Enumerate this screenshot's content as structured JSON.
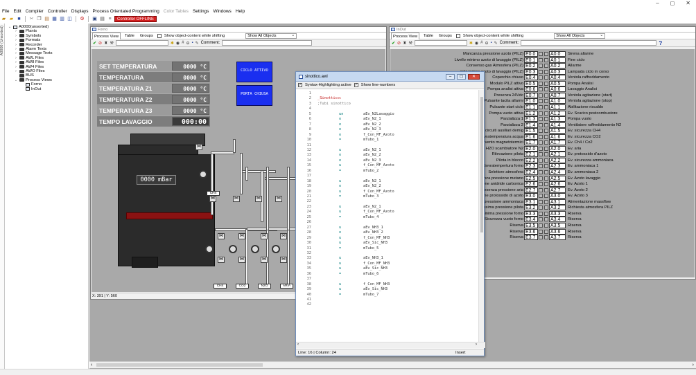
{
  "window": {
    "minimize": "–",
    "maximize": "◻",
    "close": "✕"
  },
  "menu": [
    "File",
    "Edit",
    "Compiler",
    "Controller",
    "Displays",
    "Process Orientated Programming",
    "Color Tables",
    "Settings",
    "Windows",
    "Help"
  ],
  "toolbar": {
    "controller_status": "Controller OFFLINE"
  },
  "left_panel": {
    "vtab": "A0000 (Unsorted)"
  },
  "tree": [
    {
      "label": "A0000(unsorted)",
      "depth": 0,
      "expand": "⌄",
      "icon": "chart"
    },
    {
      "label": "Plants",
      "depth": 1,
      "expand": "›",
      "icon": "folder"
    },
    {
      "label": "Symbols",
      "depth": 1,
      "expand": "›",
      "icon": "folder"
    },
    {
      "label": "Formats",
      "depth": 1,
      "expand": "›",
      "icon": "folder"
    },
    {
      "label": "Recorder",
      "depth": 1,
      "expand": "›",
      "icon": "folder"
    },
    {
      "label": "Alarm Texts",
      "depth": 1,
      "expand": "›",
      "icon": "folder"
    },
    {
      "label": "Message Texts",
      "depth": 1,
      "expand": "›",
      "icon": "folder"
    },
    {
      "label": "AWL Files",
      "depth": 1,
      "expand": "›",
      "icon": "folder"
    },
    {
      "label": "AW8 Files",
      "depth": 1,
      "expand": "›",
      "icon": "folder"
    },
    {
      "label": "AW4 Files",
      "depth": 1,
      "expand": "›",
      "icon": "folder"
    },
    {
      "label": "AWO Files",
      "depth": 1,
      "expand": "›",
      "icon": "folder"
    },
    {
      "label": "BUS",
      "depth": 1,
      "expand": "",
      "icon": "folder"
    },
    {
      "label": "Process Views",
      "depth": 1,
      "expand": "⌄",
      "icon": "folder"
    },
    {
      "label": "Forno",
      "depth": 2,
      "expand": "",
      "icon": "chart"
    },
    {
      "label": "InOut",
      "depth": 2,
      "expand": "",
      "icon": "chart"
    }
  ],
  "forno": {
    "title": "Forno",
    "tabs": [
      "Process View",
      "Table",
      "Groups"
    ],
    "show_object_content": "Show object-content while shifting",
    "filter": "Show All Objects",
    "comment_label": "Comment:",
    "temps": [
      {
        "label": "SET TEMPERATURA",
        "value": "0000 °C"
      },
      {
        "label": "TEMPERATURA",
        "value": "0000 °C"
      },
      {
        "label": "TEMPERATURA Z1",
        "value": "0000 °C"
      },
      {
        "label": "TEMPERATURA Z2",
        "value": "0000 °C"
      },
      {
        "label": "TEMPERATURA Z3",
        "value": "0000 °C"
      },
      {
        "label": "TEMPO LAVAGGIO",
        "value": "000:00"
      }
    ],
    "btn_1": "CICLO ATTIVO",
    "btn_2": "PORTA CHIUSA",
    "pressure": "0000 mBar",
    "gases": [
      "CH4",
      "CH4",
      "CO2",
      "N2O",
      "ARIA"
    ],
    "coords": "X: 391 | Y: 560"
  },
  "inout": {
    "title": "InOut",
    "tabs": [
      "Process View",
      "Table",
      "Groups"
    ],
    "show_object_content": "Show object-content while shifting",
    "filter": "Show All Objects",
    "comment_label": "Comment:",
    "help": "?",
    "rows": [
      {
        "in": "Mancanza pressione azoto (PILZ)",
        "in_addr": "E0.0",
        "out_addr": "A0.0",
        "out": "Sirena allarme"
      },
      {
        "in": "Livello minimo azoto di lavaggio (PILZ)",
        "in_addr": "E0.1",
        "out_addr": "A0.1",
        "out": "Fine ciclo"
      },
      {
        "in": "Consenso gas Atmosfera (PILZ)",
        "in_addr": "E0.2",
        "out_addr": "A0.2",
        "out": "Allarme"
      },
      {
        "in": "ggio tempo azoto di lavaggio (PILZ)",
        "in_addr": "E0.3",
        "out_addr": "A0.3",
        "out": "Lampada ciclo in corso"
      },
      {
        "in": "Coperchio chiuso",
        "in_addr": "E0.4",
        "out_addr": "A0.4",
        "out": "Ventola raffreddamento"
      },
      {
        "in": "Modulo PILZ attivo",
        "in_addr": "E0.5",
        "out_addr": "A0.5",
        "out": "Pompa Analisi"
      },
      {
        "in": "Pompa analisi attiva",
        "in_addr": "E0.6",
        "out_addr": "A0.6",
        "out": "Lavaggio Analisi"
      },
      {
        "in": "Presenza 24Vdc",
        "in_addr": "E0.7",
        "out_addr": "A0.7",
        "out": "Ventola agitazione (start)"
      },
      {
        "in": "Pulsante tacita allarmi",
        "in_addr": "E1.0",
        "out_addr": "A1.0",
        "out": "Ventola agitazione (stop)"
      },
      {
        "in": "Pulsante start ciclo",
        "in_addr": "E1.1",
        "out_addr": "A1.1",
        "out": "Abilitazione riscaldo"
      },
      {
        "in": "Pompa vuoto attiva",
        "in_addr": "E1.2",
        "out_addr": "A1.2",
        "out": "Ev. Scarico postcombustore"
      },
      {
        "in": "Parzializza 1",
        "in_addr": "E1.3",
        "out_addr": "A1.3",
        "out": "Pompa vuoto"
      },
      {
        "in": "Parzializza 2",
        "in_addr": "E1.4",
        "out_addr": "A1.4",
        "out": "Ventilatore raffreddamento N2"
      },
      {
        "in": "Allarme circuiti ausiliari demig",
        "in_addr": "E1.5",
        "out_addr": "A1.5",
        "out": "Ev. sicurezza CH4"
      },
      {
        "in": "Sovratemperatura acqua",
        "in_addr": "E1.6",
        "out_addr": "A1.6",
        "out": "Ev. sicurezza CO2"
      },
      {
        "in": "Intervento magnetotermici",
        "in_addr": "E1.7",
        "out_addr": "A1.7",
        "out": "Ev. Ch4 / Co2"
      },
      {
        "in": "emperatura H2O scambiatore N2",
        "in_addr": "E2.0",
        "out_addr": "A2.0",
        "out": "Ev. aria"
      },
      {
        "in": "Rilevazione pilota",
        "in_addr": "E2.1",
        "out_addr": "A2.1",
        "out": "Ev. protossido d'azoto"
      },
      {
        "in": "Pilota in blocco",
        "in_addr": "E2.2",
        "out_addr": "A2.2",
        "out": "Ev. sicurezza ammoniaca"
      },
      {
        "in": "Sovratempertura forno",
        "in_addr": "E2.3",
        "out_addr": "A2.3",
        "out": "Ev. ammoniaca 1"
      },
      {
        "in": "Selettore atmosfera",
        "in_addr": "E2.4",
        "out_addr": "A2.4",
        "out": "Ev. ammoniaca 2"
      },
      {
        "in": "ostato presenza pressione metano",
        "in_addr": "E2.5",
        "out_addr": "A2.5",
        "out": "Ev. Azoto lavaggio"
      },
      {
        "in": "enza pressione anidride carbonica",
        "in_addr": "E2.6",
        "out_addr": "A2.6",
        "out": "Ev. Azoto 1"
      },
      {
        "in": "essostato presenza pressione aria",
        "in_addr": "E2.7",
        "out_addr": "A2.7",
        "out": "Ev. Azoto 2"
      },
      {
        "in": "essione protossido di azoto",
        "in_addr": "E3.0",
        "out_addr": "A3.0",
        "out": "Ev. Azoto 3"
      },
      {
        "in": "o presenza pressione ammoniaca",
        "in_addr": "E3.1",
        "out_addr": "A3.1",
        "out": "Alimentazione massflow"
      },
      {
        "in": "Minima/Massima pressione pilota",
        "in_addr": "E3.2",
        "out_addr": "A3.2",
        "out": "Richiesta atmosfera PILZ"
      },
      {
        "in": "Sicurezza minima pressione forno",
        "in_addr": "E3.3",
        "out_addr": "A3.3",
        "out": "Riserva"
      },
      {
        "in": "Sicurezza vuoto forno",
        "in_addr": "E3.4",
        "out_addr": "A3.4",
        "out": "Riserva"
      },
      {
        "in": "Riserva",
        "in_addr": "E3.5",
        "out_addr": "A3.5",
        "out": "Riserva"
      },
      {
        "in": "Riserva",
        "in_addr": "E3.6",
        "out_addr": "A3.6",
        "out": "Riserva"
      },
      {
        "in": "Riserva",
        "in_addr": "E3.7",
        "out_addr": "A3.7",
        "out": "Riserva"
      }
    ]
  },
  "editor": {
    "title": "sinottico.awl",
    "opt_syntax": "Syntax-Highlighting active",
    "opt_lines": "Show line-numbers",
    "status_pos": "Line: 16 | Column: 24",
    "status_mode": "Insert",
    "lines": [
      {
        "n": "1",
        "kind": "blank",
        "op": "",
        "txt": ""
      },
      {
        "n": "2",
        "kind": "label",
        "op": "",
        "txt": "_Sinottico:"
      },
      {
        "n": "3",
        "kind": "comment",
        "op": "",
        "txt": ";Tubi sinottico"
      },
      {
        "n": "4",
        "kind": "blank",
        "op": "",
        "txt": ""
      },
      {
        "n": "5",
        "kind": "code",
        "op": "un",
        "txt": "aEv_N2Lavaggio"
      },
      {
        "n": "6",
        "kind": "code",
        "op": "o",
        "txt": "aEv_N2_1"
      },
      {
        "n": "7",
        "kind": "code",
        "op": "o",
        "txt": "aEv_N2_2"
      },
      {
        "n": "8",
        "kind": "code",
        "op": "o",
        "txt": "aEv_N2_3"
      },
      {
        "n": "9",
        "kind": "code",
        "op": "o",
        "txt": "f_Con_MF_Azoto"
      },
      {
        "n": "10",
        "kind": "code",
        "op": "=",
        "txt": "mTubo_1"
      },
      {
        "n": "11",
        "kind": "blank",
        "op": "",
        "txt": ""
      },
      {
        "n": "12",
        "kind": "code",
        "op": "u",
        "txt": "aEv_N2_1"
      },
      {
        "n": "13",
        "kind": "code",
        "op": "o",
        "txt": "aEv_N2_2"
      },
      {
        "n": "14",
        "kind": "code",
        "op": "o",
        "txt": "aEv_N2_3"
      },
      {
        "n": "15",
        "kind": "code",
        "op": "u",
        "txt": "f_Con_MF_Azoto"
      },
      {
        "n": "16",
        "kind": "code",
        "op": "=",
        "txt": "mTubo_2"
      },
      {
        "n": "17",
        "kind": "blank",
        "op": "",
        "txt": ""
      },
      {
        "n": "18",
        "kind": "code",
        "op": "u",
        "txt": "aEv_N2_1"
      },
      {
        "n": "19",
        "kind": "code",
        "op": "o",
        "txt": "aEv_N2_2"
      },
      {
        "n": "20",
        "kind": "code",
        "op": "u",
        "txt": "f_Con_MF_Azoto"
      },
      {
        "n": "21",
        "kind": "code",
        "op": "=",
        "txt": "mTubo_3"
      },
      {
        "n": "22",
        "kind": "blank",
        "op": "",
        "txt": ""
      },
      {
        "n": "23",
        "kind": "code",
        "op": "u",
        "txt": "aEv_N2_1"
      },
      {
        "n": "24",
        "kind": "code",
        "op": "u",
        "txt": "f_Con_MF_Azoto"
      },
      {
        "n": "25",
        "kind": "code",
        "op": "=",
        "txt": "mTubo_4"
      },
      {
        "n": "26",
        "kind": "blank",
        "op": "",
        "txt": ""
      },
      {
        "n": "27",
        "kind": "code",
        "op": "u",
        "txt": "aEv_NH3_1"
      },
      {
        "n": "28",
        "kind": "code",
        "op": "o",
        "txt": "aEv_NH3_2"
      },
      {
        "n": "29",
        "kind": "code",
        "op": "u",
        "txt": "f_Con_MF_NH3"
      },
      {
        "n": "30",
        "kind": "code",
        "op": "u",
        "txt": "aEv_Sic_NH3"
      },
      {
        "n": "31",
        "kind": "code",
        "op": "=",
        "txt": "mTubo_5"
      },
      {
        "n": "32",
        "kind": "blank",
        "op": "",
        "txt": ""
      },
      {
        "n": "33",
        "kind": "code",
        "op": "u",
        "txt": "aEv_NH3_1"
      },
      {
        "n": "34",
        "kind": "code",
        "op": "u",
        "txt": "f_Con_MF_NH3"
      },
      {
        "n": "35",
        "kind": "code",
        "op": "u",
        "txt": "aEv_Sic_NH3"
      },
      {
        "n": "36",
        "kind": "code",
        "op": "=",
        "txt": "mTubo_6"
      },
      {
        "n": "37",
        "kind": "blank",
        "op": "",
        "txt": ""
      },
      {
        "n": "38",
        "kind": "code",
        "op": "u",
        "txt": "f_Con_MF_NH3"
      },
      {
        "n": "39",
        "kind": "code",
        "op": "u",
        "txt": "aEv_Sic_NH3"
      },
      {
        "n": "40",
        "kind": "code",
        "op": "=",
        "txt": "mTubo_7"
      },
      {
        "n": "41",
        "kind": "blank",
        "op": "",
        "txt": ""
      },
      {
        "n": "42",
        "kind": "blank",
        "op": "",
        "txt": ""
      }
    ]
  }
}
